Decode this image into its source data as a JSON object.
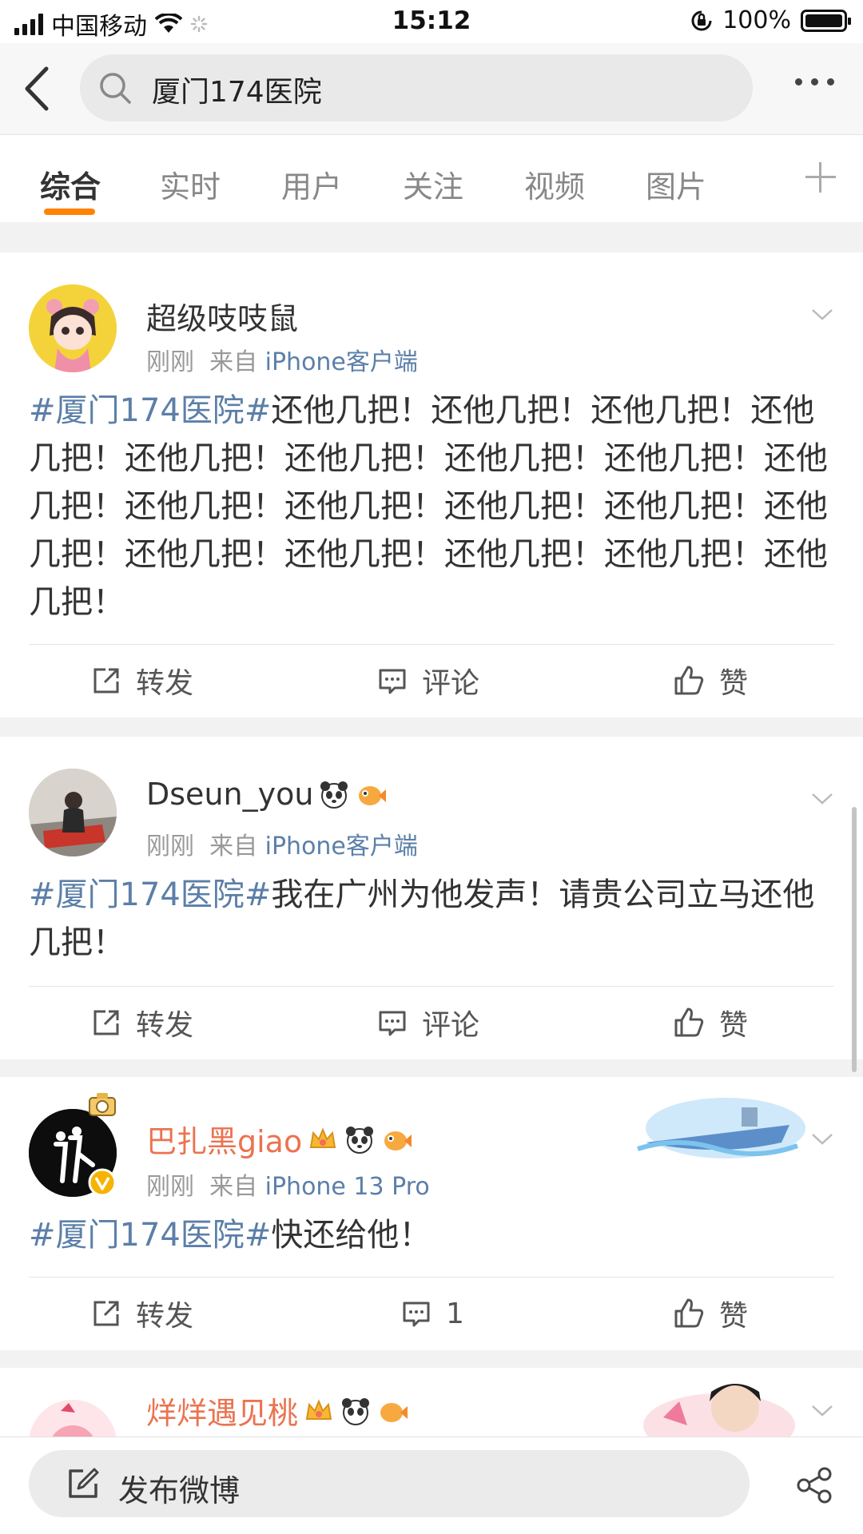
{
  "status_bar": {
    "carrier": "中国移动",
    "time": "15:12",
    "battery": "100%"
  },
  "search": {
    "query": "厦门174医院"
  },
  "tabs": [
    "综合",
    "实时",
    "用户",
    "关注",
    "视频",
    "图片"
  ],
  "posts": [
    {
      "username": "超级吱吱鼠",
      "time": "刚刚",
      "from_prefix": "来自",
      "source": "iPhone客户端",
      "topic": "#厦门174医院#",
      "text": "还他几把！还他几把！还他几把！还他几把！还他几把！还他几把！还他几把！还他几把！还他几把！还他几把！还他几把！还他几把！还他几把！还他几把！还他几把！还他几把！还他几把！还他几把！还他几把！",
      "actions": {
        "repost": "转发",
        "comment": "评论",
        "like": "赞"
      }
    },
    {
      "username": "Dseun_you",
      "time": "刚刚",
      "from_prefix": "来自",
      "source": "iPhone客户端",
      "topic": "#厦门174医院#",
      "text": "我在广州为他发声！请贵公司立马还他几把！",
      "actions": {
        "repost": "转发",
        "comment": "评论",
        "like": "赞"
      }
    },
    {
      "username": "巴扎黑giao",
      "time": "刚刚",
      "from_prefix": "来自",
      "source": "iPhone 13 Pro",
      "topic": "#厦门174医院#",
      "text": "快还给他！",
      "actions": {
        "repost": "转发",
        "comment": "1",
        "like": "赞"
      }
    },
    {
      "username": "烊烊遇见桃"
    }
  ],
  "bottom_bar": {
    "compose_label": "发布微博"
  },
  "colors": {
    "accent": "#ff8200",
    "link": "#5b7fa8",
    "vip_name": "#eb7350"
  }
}
